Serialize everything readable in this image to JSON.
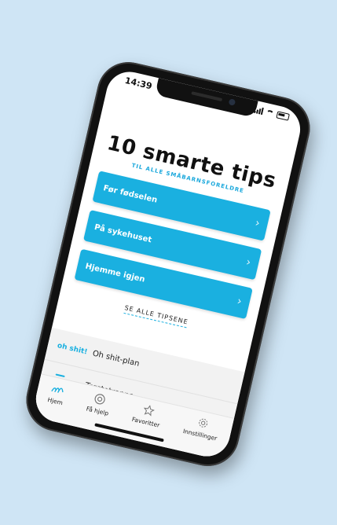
{
  "status": {
    "time": "14:39"
  },
  "header": {
    "title": "10 smarte tips",
    "subtitle": "TIL ALLE SMÅBARNSFORELDRE"
  },
  "tips": [
    {
      "label": "Før fødselen",
      "chevron": "›"
    },
    {
      "label": "På sykehuset",
      "chevron": "›"
    },
    {
      "label": "Hjemme igjen",
      "chevron": "›"
    }
  ],
  "see_all": "SE ALLE TIPSENE",
  "list": [
    {
      "brand": "oh shit!",
      "label": "Oh shit-plan"
    },
    {
      "icon": "stairs-icon",
      "label": "Trøstetrappa",
      "chevron": "›"
    },
    {
      "chevron": "›"
    }
  ],
  "tabs": [
    {
      "label": "Hjem",
      "icon": "home-icon"
    },
    {
      "label": "Få hjelp",
      "icon": "lifebuoy-icon"
    },
    {
      "label": "Favoritter",
      "icon": "star-icon"
    },
    {
      "label": "Innstillinger",
      "icon": "gear-icon"
    }
  ],
  "colors": {
    "accent": "#1ab0e0",
    "background": "#cfe5f5"
  }
}
